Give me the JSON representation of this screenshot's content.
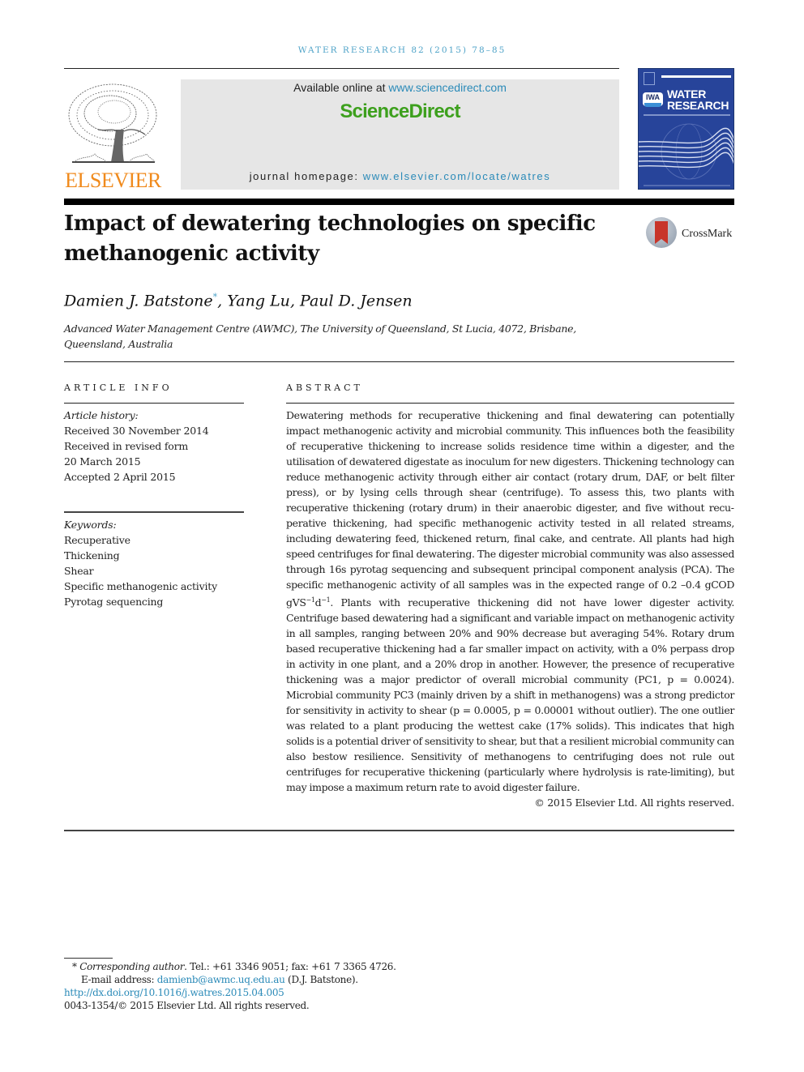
{
  "running_head": "WATER RESEARCH 82 (2015) 78–85",
  "publisher": {
    "logo_word": "ELSEVIER",
    "logo_color": "#f08a1c"
  },
  "banner": {
    "available_prefix": "Available online at ",
    "available_link": "www.sciencedirect.com",
    "brand": "ScienceDirect",
    "brand_color": "#3da01d",
    "homepage_prefix": "journal homepage: ",
    "homepage_link": "www.elsevier.com/locate/watres",
    "link_color": "#2a8ab8"
  },
  "cover": {
    "association": "IWA",
    "title_line1": "WATER",
    "title_line2": "RESEARCH",
    "color": "#27449a"
  },
  "article": {
    "title": "Impact of dewatering technologies on specific methanogenic activity",
    "crossmark_label": "CrossMark",
    "authors": [
      {
        "name": "Damien J. Batstone",
        "corresponding_mark": "*"
      },
      {
        "name": "Yang Lu"
      },
      {
        "name": "Paul D. Jensen"
      }
    ],
    "affiliation": "Advanced Water Management Centre (AWMC), The University of Queensland, St Lucia, 4072, Brisbane, Queensland, Australia"
  },
  "article_info": {
    "heading": "ARTICLE INFO",
    "history_label": "Article history:",
    "history": [
      "Received 30 November 2014",
      "Received in revised form",
      "20 March 2015",
      "Accepted 2 April 2015"
    ],
    "keywords_label": "Keywords:",
    "keywords": [
      "Recuperative",
      "Thickening",
      "Shear",
      "Specific methanogenic activity",
      "Pyrotag sequencing"
    ]
  },
  "abstract": {
    "heading": "ABSTRACT",
    "text_part1": "Dewatering methods for recuperative thickening and final dewatering can potentially impact methanogenic activity and microbial community. This influences both the feasi­bility of recuperative thickening to increase solids residence time within a digester, and the utilisation of dewatered digestate as inoculum for new digesters. Thickening technology can reduce methanogenic activity through either air contact (rotary drum, DAF, or belt filter press), or by lysing cells through shear (centrifuge). To assess this, two plants with recuperative thickening (rotary drum) in their anaerobic digester, and five without recu­perative thickening, had specific methanogenic activity tested in all related streams, including dewatering feed, thickened return, final cake, and centrate. All plants had high speed centrifuges for final dewatering. The digester microbial community was also assessed through 16s pyrotag sequencing and subsequent principal component analysis (PCA). The specific methanogenic activity of all samples was in the expected range of 0.2 –0.4 gCOD gVS",
    "sup1": "−1",
    "unit_d": "d",
    "sup2": "−1",
    "text_part2": ". Plants with recuperative thickening did not have lower digester ac­tivity. Centrifuge based dewatering had a significant and variable impact on methanogenic activity in all samples, ranging between 20% and 90% decrease but averaging 54%. Rotary drum based recuperative thickening had a far smaller impact on activity, with a 0% per­pass drop in activity in one plant, and a 20% drop in another. However, the presence of recuperative thickening was a major predictor of overall microbial community (PC1, p = 0.0024). Microbial community PC3 (mainly driven by a shift in methanogens) was a strong predictor for sensitivity in activity to shear (p = 0.0005, p = 0.00001 without outlier). The one outlier was related to a plant producing the wettest cake (17% solids). This in­dicates that high solids is a potential driver of sensitivity to shear, but that a resilient microbial community can also bestow resilience. Sensitivity of methanogens to centri­fuging does not rule out centrifuges for recuperative thickening (particularly where hy­drolysis is rate-limiting), but may impose a maximum return rate to avoid digester failure.",
    "copyright": "© 2015 Elsevier Ltd. All rights reserved."
  },
  "footnotes": {
    "mark": "*",
    "corresponding_label": "Corresponding author",
    "contact": ". Tel.: +61 3346 9051; fax: +61 7 3365 4726.",
    "email_label": "E-mail address: ",
    "email": "damienb@awmc.uq.edu.au",
    "email_suffix": " (D.J. Batstone).",
    "doi": "http://dx.doi.org/10.1016/j.watres.2015.04.005",
    "issn_line": "0043-1354/© 2015 Elsevier Ltd. All rights reserved."
  }
}
